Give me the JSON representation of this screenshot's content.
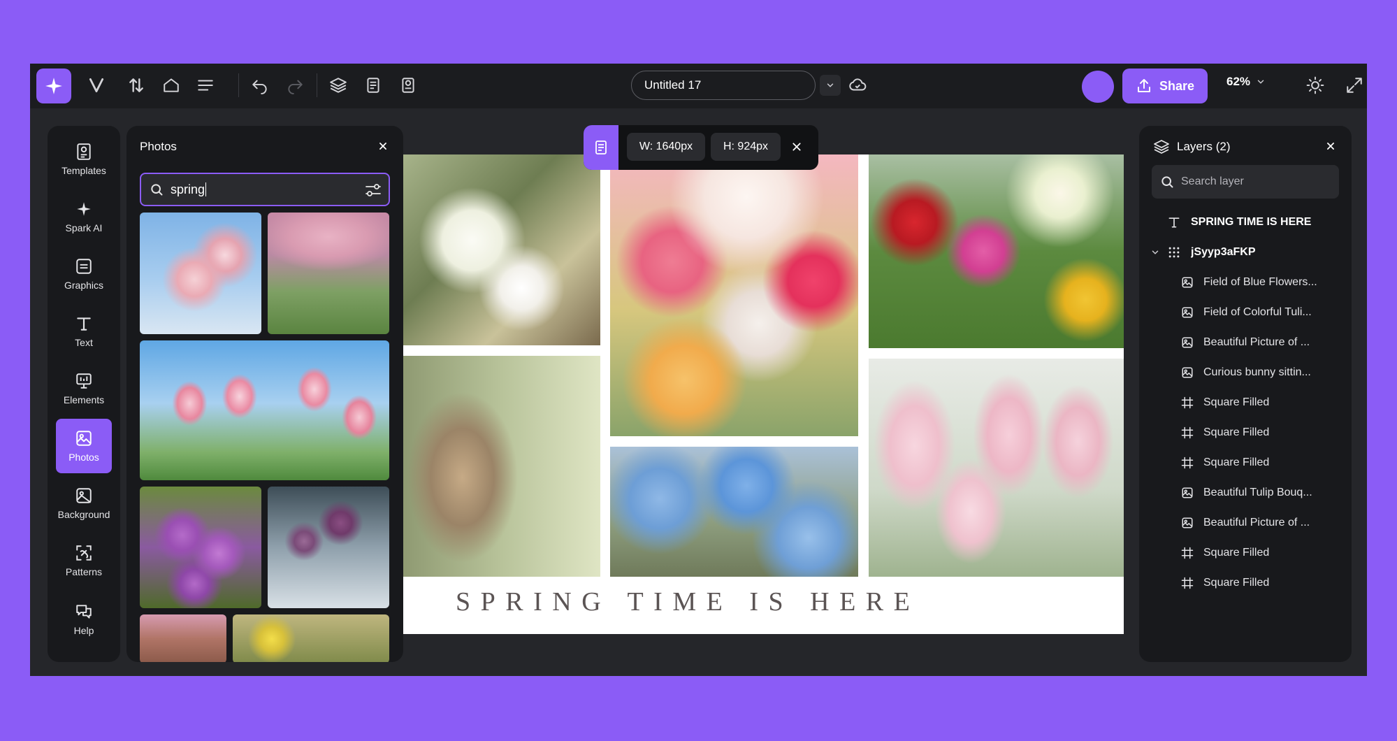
{
  "topbar": {
    "doc_title": "Untitled 17",
    "share_label": "Share",
    "zoom_label": "62%"
  },
  "rail": {
    "items": [
      {
        "label": "Templates",
        "icon": "templates-icon"
      },
      {
        "label": "Spark AI",
        "icon": "sparkle-icon"
      },
      {
        "label": "Graphics",
        "icon": "graphics-icon"
      },
      {
        "label": "Text",
        "icon": "text-icon"
      },
      {
        "label": "Elements",
        "icon": "elements-icon"
      },
      {
        "label": "Photos",
        "icon": "photos-icon",
        "active": true
      },
      {
        "label": "Background",
        "icon": "background-icon"
      },
      {
        "label": "Patterns",
        "icon": "patterns-icon"
      },
      {
        "label": "Help",
        "icon": "help-icon"
      }
    ]
  },
  "photos_panel": {
    "title": "Photos",
    "search_value": "spring"
  },
  "floating_toolbar": {
    "width_label": "W: 1640px",
    "height_label": "H: 924px"
  },
  "design": {
    "headline": "SPRING TIME IS HERE"
  },
  "layers_panel": {
    "title": "Layers (2)",
    "search_placeholder": "Search layer",
    "items": [
      {
        "label": "SPRING TIME IS HERE",
        "type": "text"
      },
      {
        "label": "jSyyp3aFKP",
        "type": "group"
      },
      {
        "label": "Field of Blue Flowers...",
        "type": "image"
      },
      {
        "label": "Field of Colorful Tuli...",
        "type": "image"
      },
      {
        "label": "Beautiful Picture of ...",
        "type": "image"
      },
      {
        "label": "Curious bunny sittin...",
        "type": "image"
      },
      {
        "label": "Square Filled",
        "type": "frame"
      },
      {
        "label": "Square Filled",
        "type": "frame"
      },
      {
        "label": "Square Filled",
        "type": "frame"
      },
      {
        "label": "Beautiful Tulip Bouq...",
        "type": "image"
      },
      {
        "label": "Beautiful Picture of ...",
        "type": "image"
      },
      {
        "label": "Square Filled",
        "type": "frame"
      },
      {
        "label": "Square Filled",
        "type": "frame"
      }
    ]
  },
  "colors": {
    "accent": "#8b5cf6",
    "background": "#8b5cf6",
    "panel": "#18191c"
  }
}
